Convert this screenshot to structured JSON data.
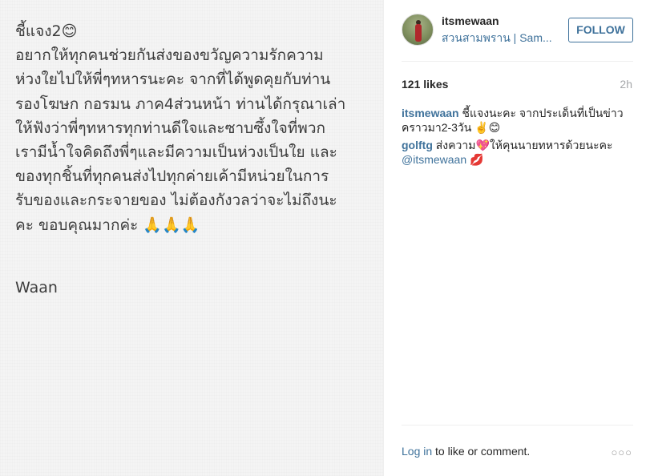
{
  "photo": {
    "lines": [
      "ชี้แจง2😊",
      "อยากให้ทุกคนช่วยกันส่งของขวัญความรักความ",
      "ห่วงใยไปให้พี่ๆทหารนะคะ จากที่ได้พูดคุยกับท่าน",
      "รองโฆษก กอรมน ภาค4ส่วนหน้า ท่านได้กรุณาเล่า",
      "ให้ฟังว่าพี่ๆทหารทุกท่านดีใจและซาบซึ้งใจที่พวก",
      "เรามีน้ำใจคิดถึงพี่ๆและมีความเป็นห่วงเป็นใย และ",
      "ของทุกชิ้นที่ทุกคนส่งไปทุกค่ายเค้ามีหน่วยในการ",
      "รับของและกระจายของ ไม่ต้องกังวลว่าจะไม่ถึงนะ",
      "คะ ขอบคุณมากค่ะ 🙏🙏🙏"
    ],
    "signature": "Waan"
  },
  "header": {
    "username": "itsmewaan",
    "location": "สวนสามพราน | Sam...",
    "follow_label": "FOLLOW"
  },
  "stats": {
    "likes": "121 likes",
    "time": "2h"
  },
  "comments": [
    {
      "user": "itsmewaan",
      "text": "ชี้แจงนะคะ จากประเด็นที่เป็นข่าวคราวมา2-3วัน ✌️😊",
      "mention": "",
      "tail": ""
    },
    {
      "user": "golftg",
      "text": "ส่งความ💖ให้คุนนายทหารด้วยนะคะ",
      "mention": "@itsmewaan",
      "tail": "💋"
    }
  ],
  "footer": {
    "login_link": "Log in",
    "login_rest": " to like or comment.",
    "more": "○○○"
  }
}
